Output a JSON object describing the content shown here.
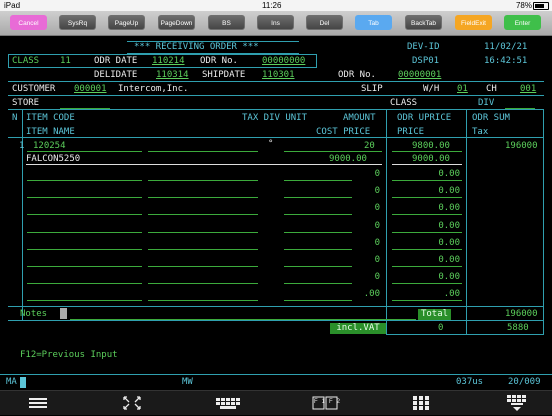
{
  "status_bar": {
    "carrier": "iPad",
    "time": "11:26",
    "battery": "78%",
    "battery_level": 0.78
  },
  "toolbar": {
    "buttons": [
      {
        "label": "Cancel",
        "color": "#e86bd6"
      },
      {
        "label": "SysRq",
        "color": "#555555"
      },
      {
        "label": "PageUp",
        "color": "#555555"
      },
      {
        "label": "PageDown",
        "color": "#555555"
      },
      {
        "label": "BS",
        "color": "#555555"
      },
      {
        "label": "Ins",
        "color": "#555555"
      },
      {
        "label": "Del",
        "color": "#555555"
      },
      {
        "label": "Tab",
        "color": "#5aa9f0"
      },
      {
        "label": "BackTab",
        "color": "#555555"
      },
      {
        "label": "FieldExit",
        "color": "#f5a623"
      },
      {
        "label": "Enter",
        "color": "#3fbf4a"
      }
    ]
  },
  "header": {
    "title": "*** RECEIVING ORDER ***",
    "dev_id_label": "DEV-ID",
    "date": "11/02/21",
    "dsp": "DSP01",
    "time": "16:42:51",
    "class_label": "CLASS",
    "class_value": "11",
    "odr_date_label": "ODR DATE",
    "odr_date": "110214",
    "odr_no_label": "ODR No.",
    "odr_no": "00000000",
    "deli_date_label": "DELIDATE",
    "deli_date": "110314",
    "ship_date_label": "SHIPDATE",
    "ship_date": "110301",
    "odr_no2_label": "ODR No.",
    "odr_no2": "00000001",
    "customer_label": "CUSTOMER",
    "customer_code": "000001",
    "customer_name": "Intercom,Inc.",
    "slip_label": "SLIP",
    "wh_label": "W/H",
    "wh_value": "01",
    "ch_label": "CH",
    "ch_value": "001",
    "store_label": "STORE",
    "class2_label": "CLASS",
    "div_label": "DIV"
  },
  "columns": {
    "n": "N",
    "item_code": "ITEM CODE",
    "tax_div_unit": "TAX DIV UNIT",
    "amount": "AMOUNT",
    "odr_uprice": "ODR UPRICE",
    "odr_sum": "ODR SUM",
    "item_name": "ITEM NAME",
    "cost_price": "COST PRICE",
    "price": "PRICE",
    "tax": "Tax"
  },
  "lines": [
    {
      "n": "1",
      "item_code": "120254",
      "tax_mark": "°",
      "amount": "20",
      "uprice": "9800.00",
      "sum": "196000",
      "item_name": "FALCON5250",
      "cost_price": "9000.00",
      "price": "9000.00"
    },
    {
      "cost_price": "0",
      "price": "0.00"
    },
    {
      "cost_price": "0",
      "price": "0.00"
    },
    {
      "cost_price": "0",
      "price": "0.00"
    },
    {
      "cost_price": "0",
      "price": "0.00"
    },
    {
      "cost_price": "0",
      "price": "0.00"
    },
    {
      "cost_price": "0",
      "price": "0.00"
    },
    {
      "cost_price": "0",
      "price": "0.00"
    },
    {
      "cost_price": ".00",
      "price": ".00"
    }
  ],
  "footer": {
    "notes_label": "Notes",
    "total_label": "Total",
    "total_value": "196000",
    "incl_vat_label": "incl.VAT",
    "incl_vat_value": "0",
    "vat_value": "5880",
    "f12_text": "F12=Previous Input"
  },
  "oia": {
    "ma": "MA",
    "mw": "MW",
    "response": "037us",
    "cursor_pos": "20/009"
  },
  "bottom_bar": {
    "icons": [
      "menu-icon",
      "expand-icon",
      "keyboard-icon",
      "function-keys-icon",
      "keypad-icon",
      "keyboard-hide-icon"
    ],
    "fkey_label": "F1F2"
  }
}
